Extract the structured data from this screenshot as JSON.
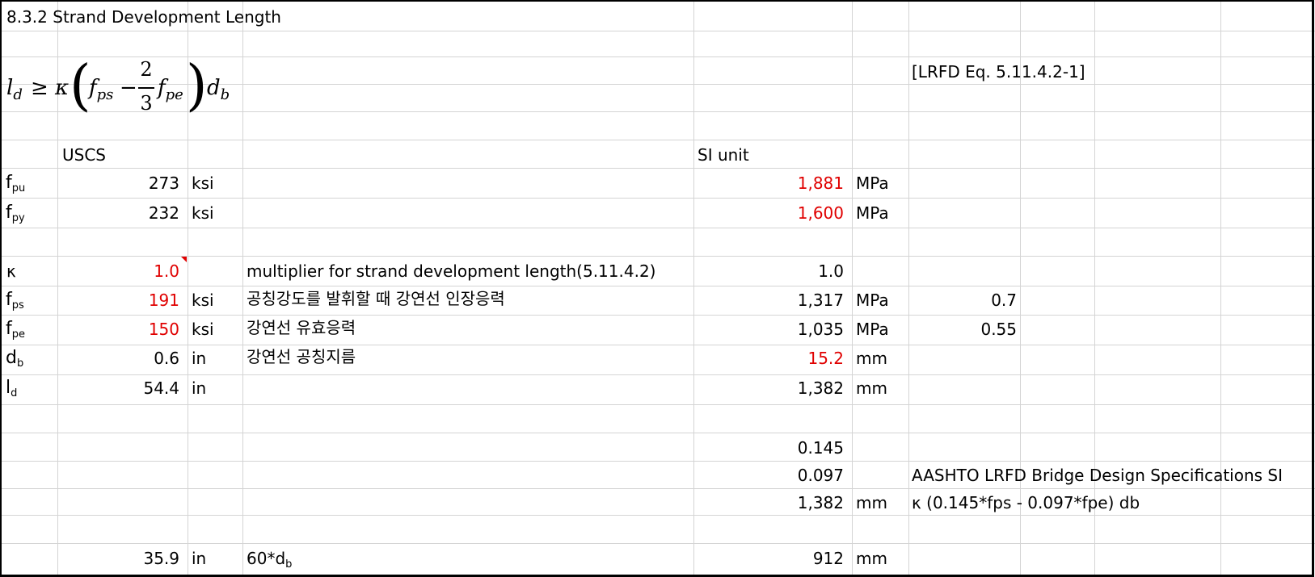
{
  "title": "8.3.2 Strand Development Length",
  "equation": {
    "lhs": "l",
    "lhs_sub": "d",
    "relation": "≥",
    "kappa": "κ",
    "f": "f",
    "ps_sub": "ps",
    "minus": "−",
    "frac_num": "2",
    "frac_den": "3",
    "pe_sub": "pe",
    "d": "d",
    "b_sub": "b",
    "reference": "[LRFD Eq. 5.11.4.2-1]"
  },
  "headers": {
    "uscs": "USCS",
    "si": "SI unit"
  },
  "rows": [
    {
      "sym": "f",
      "sub": "pu",
      "uscs": "273",
      "unit": "ksi",
      "desc": "",
      "si": "1,881",
      "si_unit": "MPa",
      "extra": ""
    },
    {
      "sym": "f",
      "sub": "py",
      "uscs": "232",
      "unit": "ksi",
      "desc": "",
      "si": "1,600",
      "si_unit": "MPa",
      "extra": ""
    },
    {
      "sym": "κ",
      "sub": "",
      "uscs": "1.0",
      "unit": "",
      "desc": "multiplier for strand development length(5.11.4.2)",
      "si": "1.0",
      "si_unit": "",
      "extra": ""
    },
    {
      "sym": "f",
      "sub": "ps",
      "uscs": "191",
      "unit": "ksi",
      "desc": "공칭강도를 발휘할 때 강연선 인장응력",
      "si": "1,317",
      "si_unit": "MPa",
      "extra": "0.7"
    },
    {
      "sym": "f",
      "sub": "pe",
      "uscs": "150",
      "unit": "ksi",
      "desc": "강연선 유효응력",
      "si": "1,035",
      "si_unit": "MPa",
      "extra": "0.55"
    },
    {
      "sym": "d",
      "sub": "b",
      "uscs": "0.6",
      "unit": "in",
      "desc": "강연선 공칭지름",
      "si": "15.2",
      "si_unit": "mm",
      "extra": ""
    },
    {
      "sym": "l",
      "sub": "d",
      "uscs": "54.4",
      "unit": "in",
      "desc": "",
      "si": "1,382",
      "si_unit": "mm",
      "extra": ""
    }
  ],
  "si_factors": {
    "a": "0.145",
    "b": "0.097"
  },
  "si_result": {
    "value": "1,382",
    "unit": "mm"
  },
  "notes": {
    "spec": "AASHTO LRFD Bridge Design Specifications SI",
    "formula": "κ (0.145*fps - 0.097*fpe) db"
  },
  "min_row": {
    "uscs": "35.9",
    "unit": "in",
    "desc": "60*d",
    "desc_sub": "b",
    "si": "912",
    "si_unit": "mm"
  },
  "colors": {
    "input_red": "#e00000",
    "grid": "#d4d4d4"
  }
}
